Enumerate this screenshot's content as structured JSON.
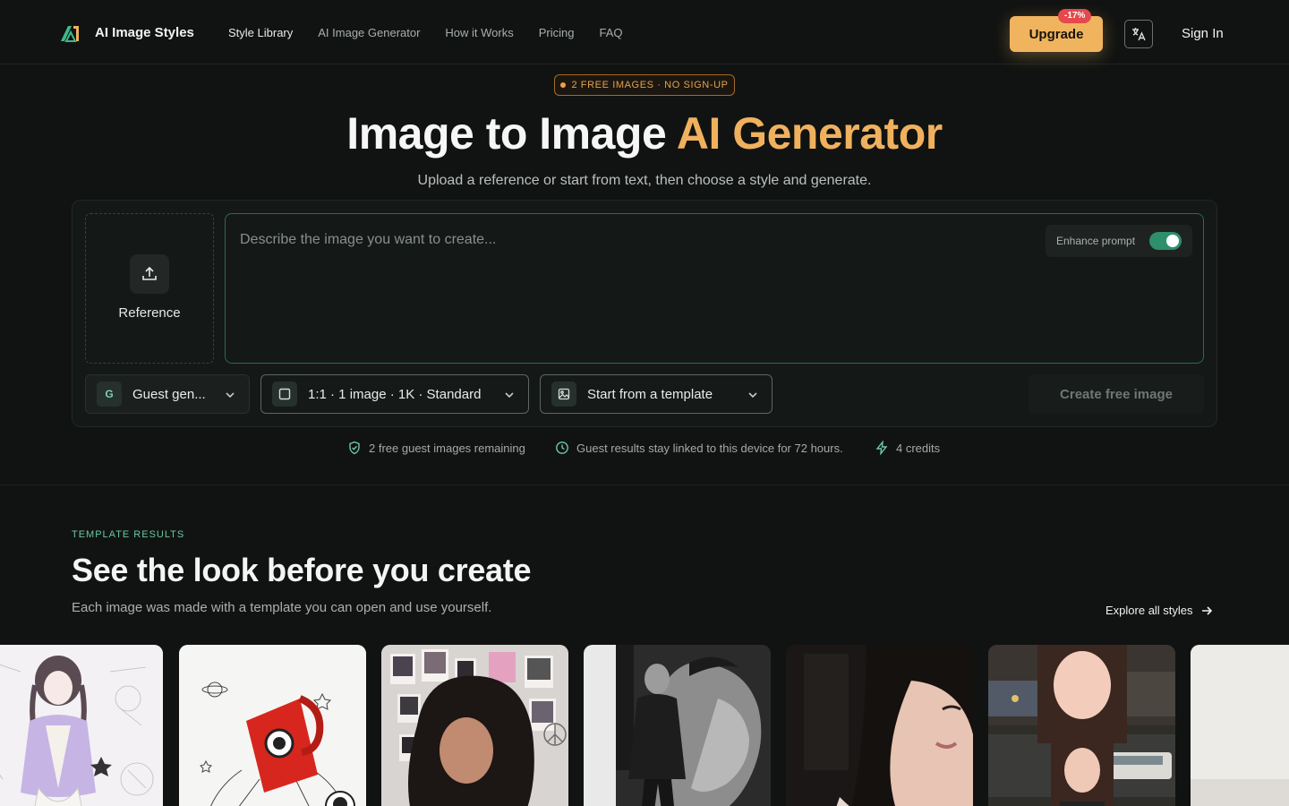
{
  "header": {
    "brand": "AI Image Styles",
    "nav": [
      "Style Library",
      "AI Image Generator",
      "How it Works",
      "Pricing",
      "FAQ"
    ],
    "upgrade_label": "Upgrade",
    "discount_badge": "-17%",
    "signin_label": "Sign In",
    "icons": {
      "logo": "brand-logo-icon",
      "language": "translate-icon"
    }
  },
  "hero": {
    "pill": "2 FREE IMAGES · NO SIGN-UP",
    "title_main": "Image to Image",
    "title_accent": "AI Generator",
    "subtitle": "Upload a reference or start from text, then choose a style and generate."
  },
  "composer": {
    "reference_label": "Reference",
    "prompt_placeholder": "Describe the image you want to create...",
    "prompt_value": "",
    "enhance_label": "Enhance prompt",
    "enhance_on": true,
    "guest_badge": "G",
    "guest_label": "Guest gen...",
    "ratio_label": "1:1 · 1 image · 1K · Standard",
    "template_label": "Start from a template",
    "create_label": "Create free image"
  },
  "info": {
    "remaining": "2 free guest images remaining",
    "retention": "Guest results stay linked to this device for 72 hours.",
    "credits": "4 credits"
  },
  "templates": {
    "eyebrow": "TEMPLATE RESULTS",
    "title": "See the look before you create",
    "subtitle": "Each image was made with a template you can open and use yourself.",
    "explore_label": "Explore all styles",
    "cards": [
      {
        "name": "anime-sketch-girl-card",
        "bg": "#e9e6ee"
      },
      {
        "name": "rocket-mug-card",
        "bg": "#f2f2f0"
      },
      {
        "name": "polaroid-wall-portrait-card",
        "bg": "#3a3a3c"
      },
      {
        "name": "bw-double-exposure-card",
        "bg": "#2b2b2b"
      },
      {
        "name": "dark-selfie-card",
        "bg": "#1f1b1a"
      },
      {
        "name": "city-night-collage-card",
        "bg": "#4a4740"
      },
      {
        "name": "partial-card",
        "bg": "#ecebe8"
      }
    ]
  },
  "colors": {
    "accent": "#f0b15e",
    "brand_green": "#2d8f6c",
    "background": "#111312"
  }
}
